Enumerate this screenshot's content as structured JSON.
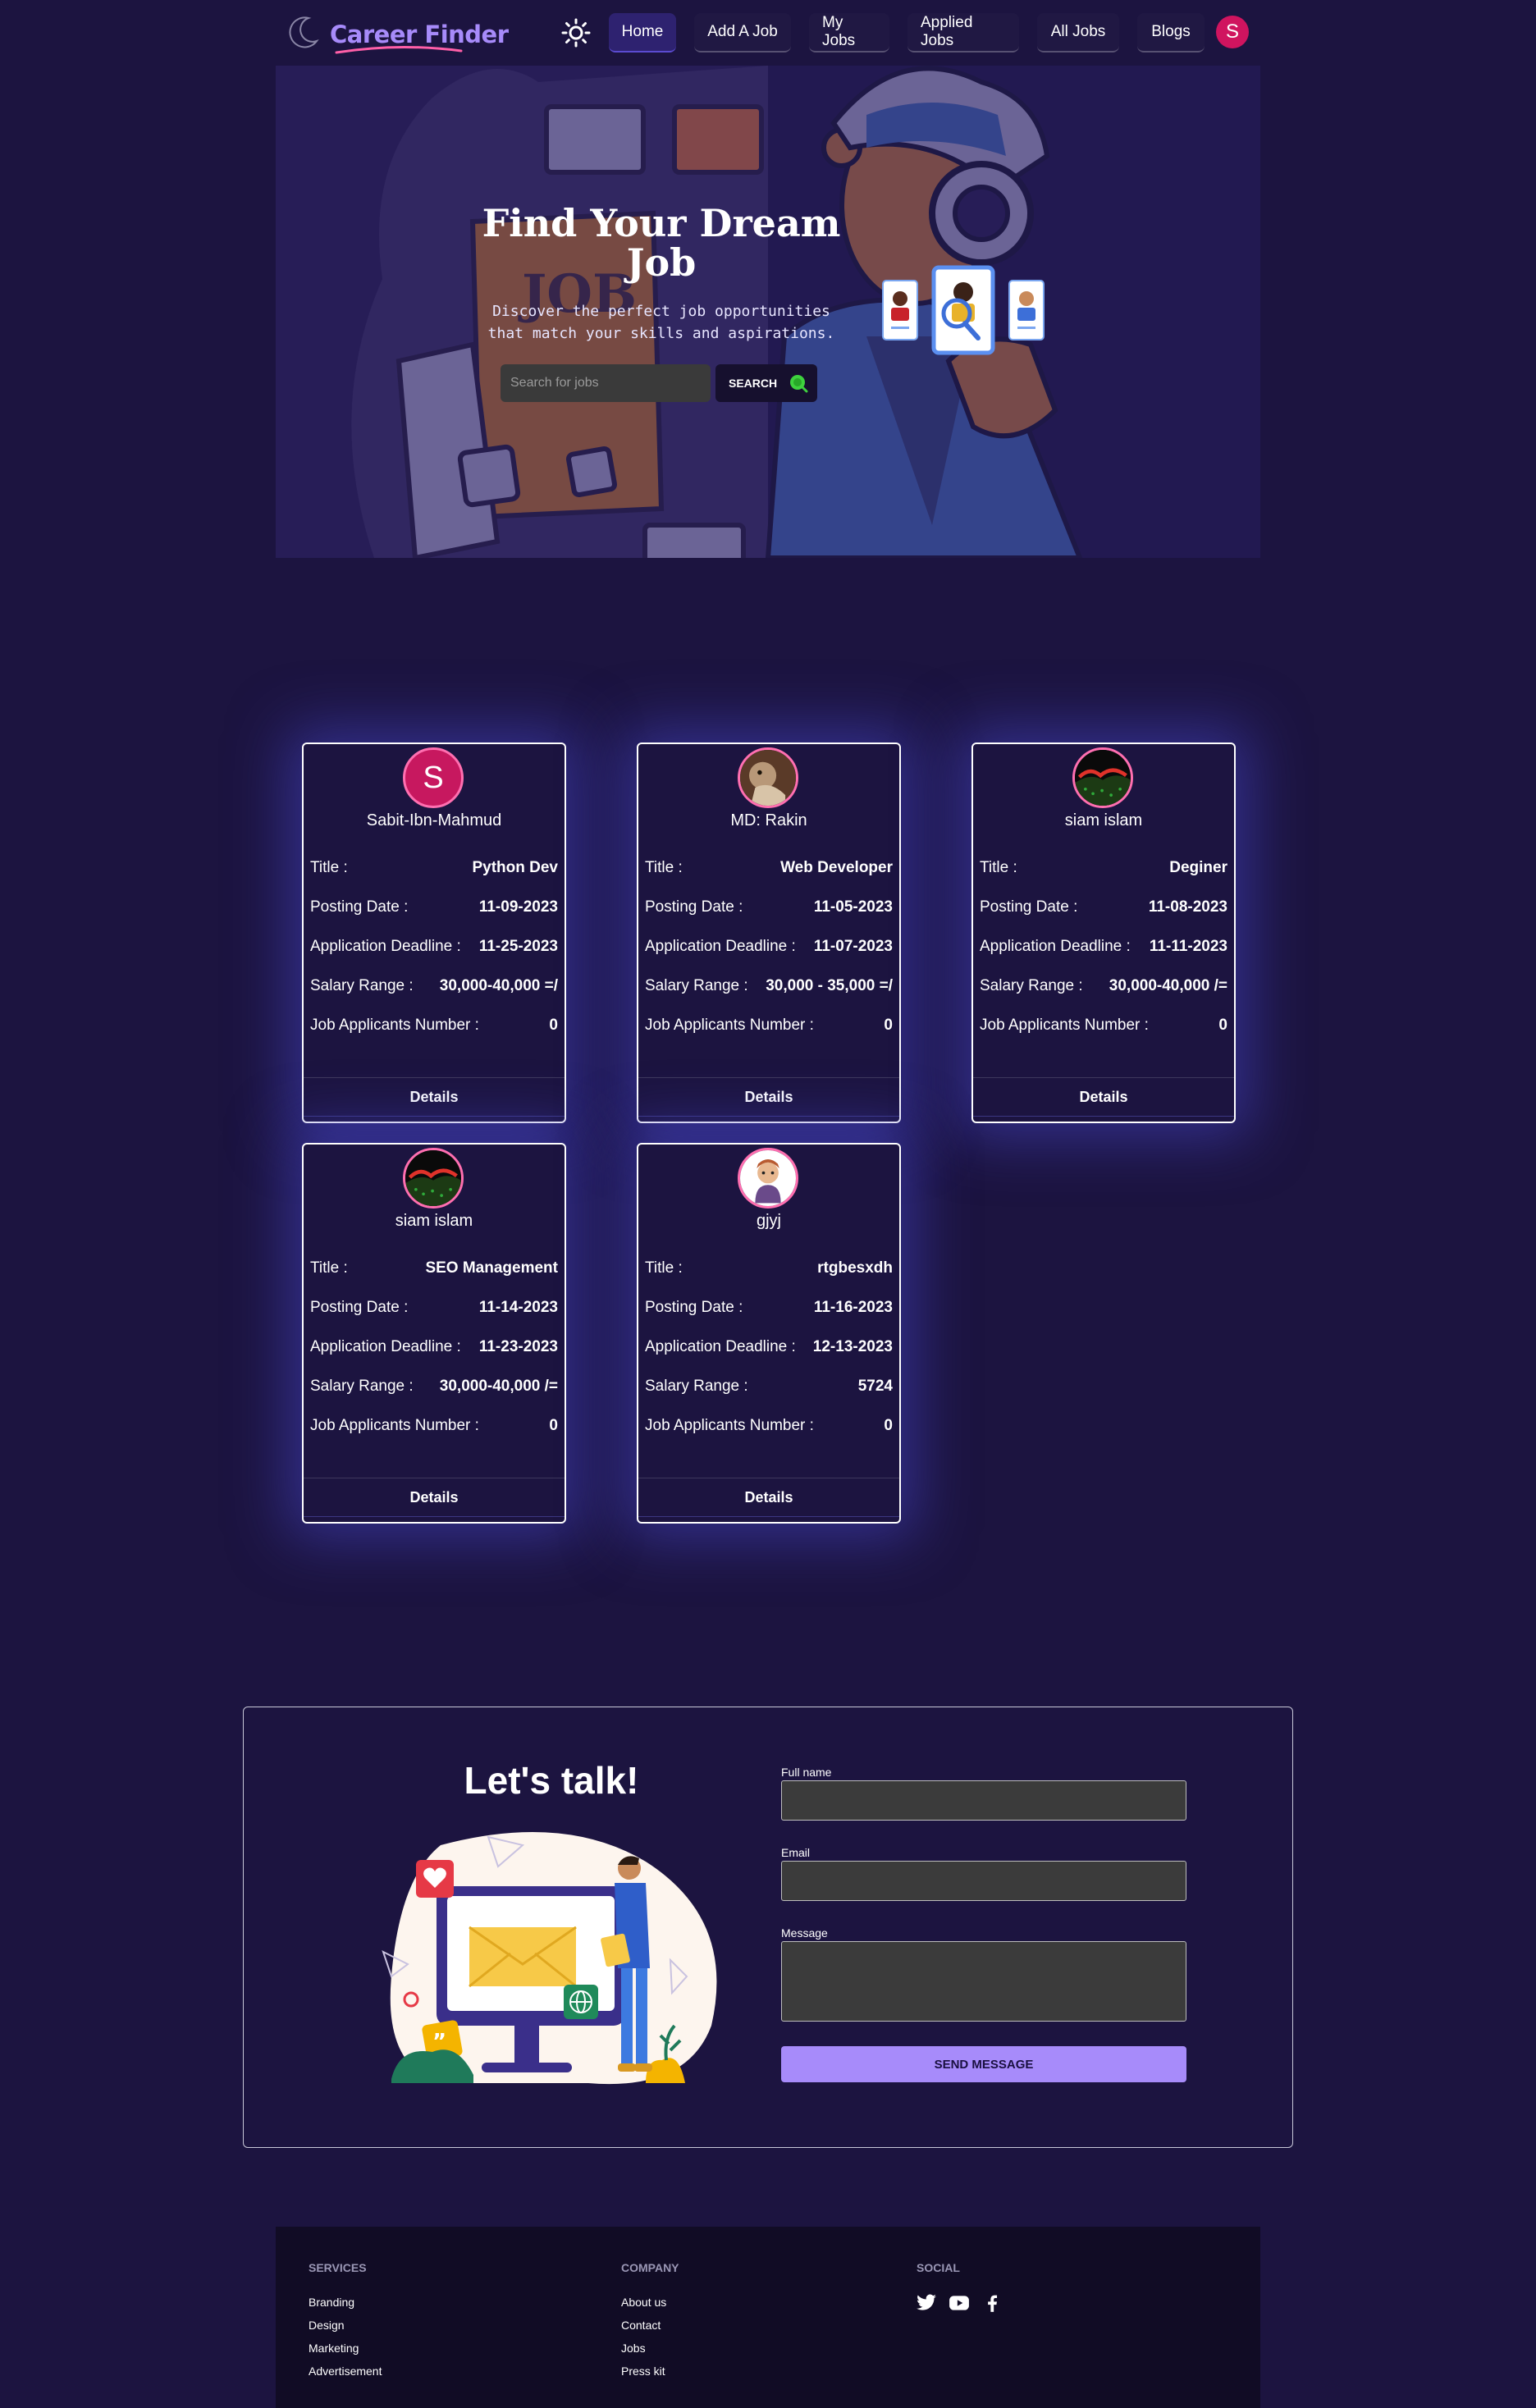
{
  "brand": {
    "name": "Career Finder"
  },
  "nav": {
    "items": [
      {
        "label": "Home"
      },
      {
        "label": "Add A Job"
      },
      {
        "label": "My Jobs"
      },
      {
        "label": "Applied Jobs"
      },
      {
        "label": "All Jobs"
      },
      {
        "label": "Blogs"
      }
    ],
    "avatar_letter": "S"
  },
  "hero": {
    "title": "Find Your Dream Job",
    "subtitle": "Discover the perfect job opportunities that match your skills and aspirations.",
    "search_placeholder": "Search for jobs",
    "search_button": "SEARCH"
  },
  "jobs": [
    {
      "poster": "Sabit-Ibn-Mahmud",
      "avatar_letter": "S",
      "title_label": "Title :",
      "title": "Python Dev",
      "posting_label": "Posting Date :",
      "posting_date": "11-09-2023",
      "deadline_label": "Application Deadline :",
      "deadline": "11-25-2023",
      "salary_label": "Salary Range :",
      "salary": "30,000-40,000 =/",
      "applicants_label": "Job Applicants Number :",
      "applicants": "0",
      "details": "Details"
    },
    {
      "poster": "MD: Rakin",
      "avatar_letter": "",
      "title_label": "Title :",
      "title": "Web Developer",
      "posting_label": "Posting Date :",
      "posting_date": "11-05-2023",
      "deadline_label": "Application Deadline :",
      "deadline": "11-07-2023",
      "salary_label": "Salary Range :",
      "salary": "30,000 - 35,000 =/",
      "applicants_label": "Job Applicants Number :",
      "applicants": "0",
      "details": "Details"
    },
    {
      "poster": "siam islam",
      "avatar_letter": "",
      "title_label": "Title :",
      "title": "Deginer",
      "posting_label": "Posting Date :",
      "posting_date": "11-08-2023",
      "deadline_label": "Application Deadline :",
      "deadline": "11-11-2023",
      "salary_label": "Salary Range :",
      "salary": "30,000-40,000 /=",
      "applicants_label": "Job Applicants Number :",
      "applicants": "0",
      "details": "Details"
    },
    {
      "poster": "siam islam",
      "avatar_letter": "",
      "title_label": "Title :",
      "title": "SEO Management",
      "posting_label": "Posting Date :",
      "posting_date": "11-14-2023",
      "deadline_label": "Application Deadline :",
      "deadline": "11-23-2023",
      "salary_label": "Salary Range :",
      "salary": "30,000-40,000 /=",
      "applicants_label": "Job Applicants Number :",
      "applicants": "0",
      "details": "Details"
    },
    {
      "poster": "gjyj",
      "avatar_letter": "",
      "title_label": "Title :",
      "title": "rtgbesxdh",
      "posting_label": "Posting Date :",
      "posting_date": "11-16-2023",
      "deadline_label": "Application Deadline :",
      "deadline": "12-13-2023",
      "salary_label": "Salary Range :",
      "salary": "5724",
      "applicants_label": "Job Applicants Number :",
      "applicants": "0",
      "details": "Details"
    }
  ],
  "contact": {
    "title": "Let's talk!",
    "fullname_label": "Full name",
    "email_label": "Email",
    "message_label": "Message",
    "send_button": "SEND MESSAGE"
  },
  "footer": {
    "services_heading": "SERVICES",
    "services": [
      "Branding",
      "Design",
      "Marketing",
      "Advertisement"
    ],
    "company_heading": "COMPANY",
    "company": [
      "About us",
      "Contact",
      "Jobs",
      "Press kit"
    ],
    "social_heading": "SOCIAL",
    "social_icons": [
      "twitter-icon",
      "youtube-icon",
      "facebook-icon"
    ]
  },
  "colors": {
    "background": "#1c1440",
    "accent": "#a78bfa",
    "avatar": "#d0145f",
    "footer": "#110c25"
  }
}
